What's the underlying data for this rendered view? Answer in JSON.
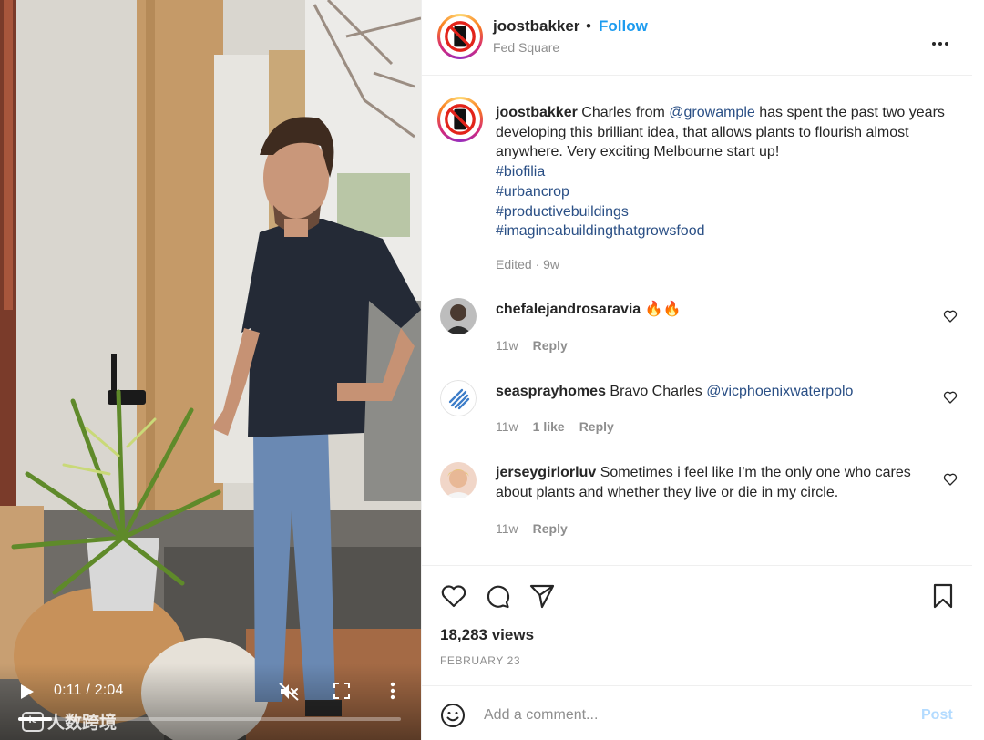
{
  "video": {
    "time": "0:11 / 2:04",
    "progress_fraction": 0.089,
    "watermark": "人数跨境"
  },
  "post": {
    "username": "joostbakker",
    "separator": "•",
    "follow_label": "Follow",
    "location": "Fed Square",
    "caption": {
      "username": "joostbakker",
      "text_1": " Charles from ",
      "mention": "@growample",
      "text_2": " has spent the past two years developing this brilliant idea, that allows plants to flourish almost anywhere. Very exciting Melbourne start up!",
      "hashtags": [
        "#biofilia",
        "#urbancrop",
        "#productivebuildings",
        "#imagineabuildingthatgrowsfood"
      ],
      "meta": "Edited · 9w"
    },
    "comments": [
      {
        "username": "chefalejandrosaravia",
        "text": " 🔥🔥",
        "mention": "",
        "age": "11w",
        "likes": "",
        "reply": "Reply"
      },
      {
        "username": "seasprayhomes",
        "text": " Bravo Charles ",
        "mention": "@vicphoenixwaterpolo",
        "age": "11w",
        "likes": "1 like",
        "reply": "Reply"
      },
      {
        "username": "jerseygirlorluv",
        "text": " Sometimes i feel like I'm the only one who cares about plants and whether they live or die in my circle.",
        "mention": "",
        "age": "11w",
        "likes": "",
        "reply": "Reply"
      }
    ],
    "views": "18,283 views",
    "date": "FEBRUARY 23",
    "add_comment_placeholder": "Add a comment...",
    "post_label": "Post"
  },
  "colors": {
    "follow": "#1c9bef",
    "link": "#2a4f85",
    "muted": "#8e8e8e",
    "post_disabled": "#b3dbff"
  },
  "icons": {
    "actions": [
      "heart-icon",
      "comment-icon",
      "share-icon",
      "bookmark-icon"
    ],
    "video_controls": [
      "play-icon",
      "muted-speaker-icon",
      "fullscreen-icon",
      "more-vertical-icon"
    ]
  }
}
